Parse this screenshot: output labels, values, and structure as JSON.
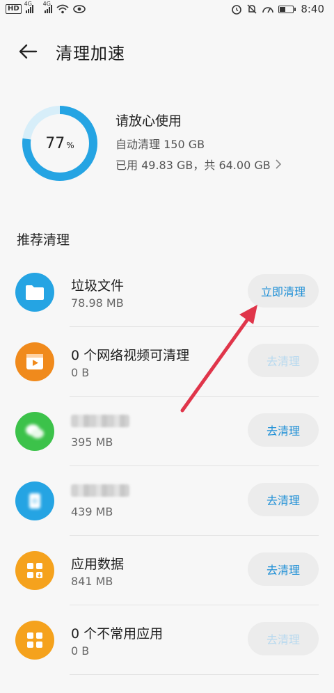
{
  "status_bar": {
    "hd": "HD",
    "net1": "4G",
    "net2": "4G",
    "time": "8:40"
  },
  "header": {
    "title": "清理加速"
  },
  "storage": {
    "percent": 77,
    "percent_value": "77",
    "percent_sign": "%",
    "status": "请放心使用",
    "auto_clean": "自动清理 150 GB",
    "usage": "已用 49.83 GB，共 64.00 GB"
  },
  "section": {
    "title": "推荐清理"
  },
  "items": [
    {
      "title": "垃圾文件",
      "size": "78.98 MB",
      "button": "立即清理",
      "enabled": true
    },
    {
      "title": "0 个网络视频可清理",
      "size": "0 B",
      "button": "去清理",
      "enabled": false
    },
    {
      "title": "",
      "size": "395 MB",
      "button": "去清理",
      "enabled": true
    },
    {
      "title": "",
      "size": "439 MB",
      "button": "去清理",
      "enabled": true
    },
    {
      "title": "应用数据",
      "size": "841 MB",
      "button": "去清理",
      "enabled": true
    },
    {
      "title": "0 个不常用应用",
      "size": "0 B",
      "button": "去清理",
      "enabled": false
    }
  ],
  "colors": {
    "accent_blue": "#1e8fd6",
    "ring_blue": "#25a4e3",
    "orange": "#f08a1c",
    "green": "#3cc24a"
  },
  "icons": {
    "folder": "folder-icon",
    "video": "video-icon",
    "wechat": "wechat-icon",
    "app_blue": "app-icon",
    "app_data": "app-data-icon",
    "apps_grid": "apps-grid-icon"
  }
}
